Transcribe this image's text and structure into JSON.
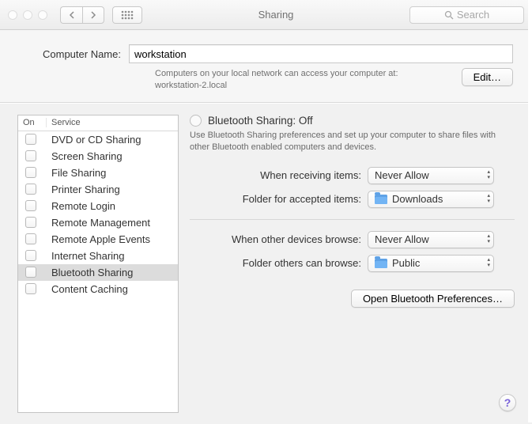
{
  "window": {
    "title": "Sharing",
    "search_placeholder": "Search"
  },
  "top": {
    "computer_name_label": "Computer Name:",
    "computer_name_value": "workstation",
    "hint_line1": "Computers on your local network can access your computer at:",
    "hint_line2": "workstation-2.local",
    "edit_label": "Edit…"
  },
  "list": {
    "header_on": "On",
    "header_service": "Service",
    "services": [
      {
        "label": "DVD or CD Sharing"
      },
      {
        "label": "Screen Sharing"
      },
      {
        "label": "File Sharing"
      },
      {
        "label": "Printer Sharing"
      },
      {
        "label": "Remote Login"
      },
      {
        "label": "Remote Management"
      },
      {
        "label": "Remote Apple Events"
      },
      {
        "label": "Internet Sharing"
      },
      {
        "label": "Bluetooth Sharing"
      },
      {
        "label": "Content Caching"
      }
    ],
    "selected_index": 8
  },
  "detail": {
    "heading": "Bluetooth Sharing: Off",
    "description": "Use Bluetooth Sharing preferences and set up your computer to share files with other Bluetooth enabled computers and devices.",
    "receive_label": "When receiving items:",
    "receive_value": "Never Allow",
    "accept_folder_label": "Folder for accepted items:",
    "accept_folder_value": "Downloads",
    "browse_label": "When other devices browse:",
    "browse_value": "Never Allow",
    "browse_folder_label": "Folder others can browse:",
    "browse_folder_value": "Public",
    "open_bt_label": "Open Bluetooth Preferences…"
  },
  "help_label": "?"
}
